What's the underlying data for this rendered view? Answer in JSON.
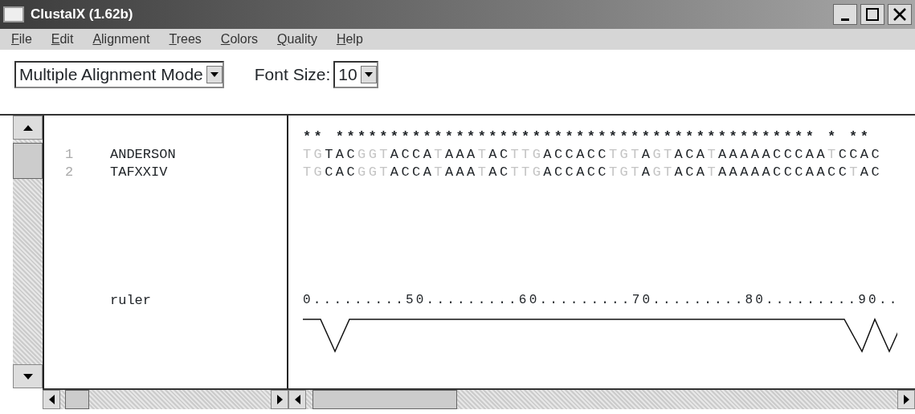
{
  "window": {
    "title": "ClustalX (1.62b)"
  },
  "menu": [
    "File",
    "Edit",
    "Alignment",
    "Trees",
    "Colors",
    "Quality",
    "Help"
  ],
  "mode_select": {
    "value": "Multiple Alignment Mode"
  },
  "font_size": {
    "label": "Font Size:",
    "value": "10"
  },
  "names": [
    {
      "number": "1",
      "name": "ANDERSON"
    },
    {
      "number": "2",
      "name": "TAFXXIV"
    }
  ],
  "ruler_label": "ruler",
  "alignment": {
    "consensus": "** ******************************************** * **",
    "sequences": [
      {
        "segments": [
          {
            "text": "TG",
            "dim": true
          },
          {
            "text": "TAC",
            "dim": false
          },
          {
            "text": "GGT",
            "dim": true
          },
          {
            "text": "ACCA",
            "dim": false
          },
          {
            "text": "T",
            "dim": true
          },
          {
            "text": "AAA",
            "dim": false
          },
          {
            "text": "T",
            "dim": true
          },
          {
            "text": "AC",
            "dim": false
          },
          {
            "text": "TTG",
            "dim": true
          },
          {
            "text": "ACCACC",
            "dim": false
          },
          {
            "text": "TGT",
            "dim": true
          },
          {
            "text": "A",
            "dim": false
          },
          {
            "text": "GT",
            "dim": true
          },
          {
            "text": "ACA",
            "dim": false
          },
          {
            "text": "T",
            "dim": true
          },
          {
            "text": "AAAAACCCAA",
            "dim": false
          },
          {
            "text": "T",
            "dim": true
          },
          {
            "text": "CCAC",
            "dim": false
          }
        ]
      },
      {
        "segments": [
          {
            "text": "TG",
            "dim": true
          },
          {
            "text": "CAC",
            "dim": false
          },
          {
            "text": "GGT",
            "dim": true
          },
          {
            "text": "ACCA",
            "dim": false
          },
          {
            "text": "T",
            "dim": true
          },
          {
            "text": "AAA",
            "dim": false
          },
          {
            "text": "T",
            "dim": true
          },
          {
            "text": "AC",
            "dim": false
          },
          {
            "text": "TTG",
            "dim": true
          },
          {
            "text": "ACCACC",
            "dim": false
          },
          {
            "text": "TGT",
            "dim": true
          },
          {
            "text": "A",
            "dim": false
          },
          {
            "text": "GT",
            "dim": true
          },
          {
            "text": "ACA",
            "dim": false
          },
          {
            "text": "T",
            "dim": true
          },
          {
            "text": "AAAAACCCAACC",
            "dim": false
          },
          {
            "text": "T",
            "dim": true
          },
          {
            "text": "AC",
            "dim": false
          }
        ]
      }
    ],
    "ruler": "0.........50.........60.........70.........80.........90.."
  }
}
